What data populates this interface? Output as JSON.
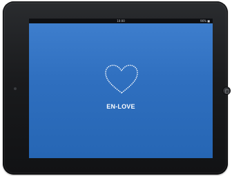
{
  "status_bar": {
    "time": "10:00",
    "battery": "96% ■"
  },
  "app": {
    "name": "EN-LOVE",
    "logo_icon": "dotted-heart-icon"
  },
  "colors": {
    "screen_background": "#2f6fbf",
    "device_bezel": "#1a1b1d",
    "logo_dots": "#ffffff",
    "app_name_text": "#ffffff"
  }
}
